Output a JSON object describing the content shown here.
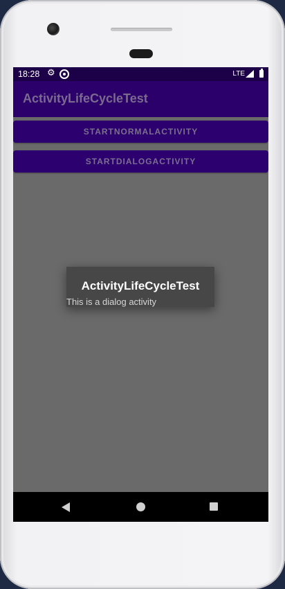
{
  "status_bar": {
    "time": "18:28",
    "network": "LTE",
    "icons": [
      "gear-icon",
      "sync-icon",
      "signal-icon",
      "battery-icon"
    ]
  },
  "app": {
    "title": "ActivityLifeCycleTest",
    "colors": {
      "primary": "#2b006b",
      "status_bar": "#1c0048",
      "scrim": "#6a6a6a"
    }
  },
  "buttons": {
    "start_normal": "STARTNORMALACTIVITY",
    "start_dialog": "STARTDIALOGACTIVITY"
  },
  "dialog": {
    "title": "ActivityLifeCycleTest",
    "message": "This is a dialog activity"
  },
  "navigation": {
    "icons": [
      "back-icon",
      "home-icon",
      "recents-icon"
    ]
  }
}
